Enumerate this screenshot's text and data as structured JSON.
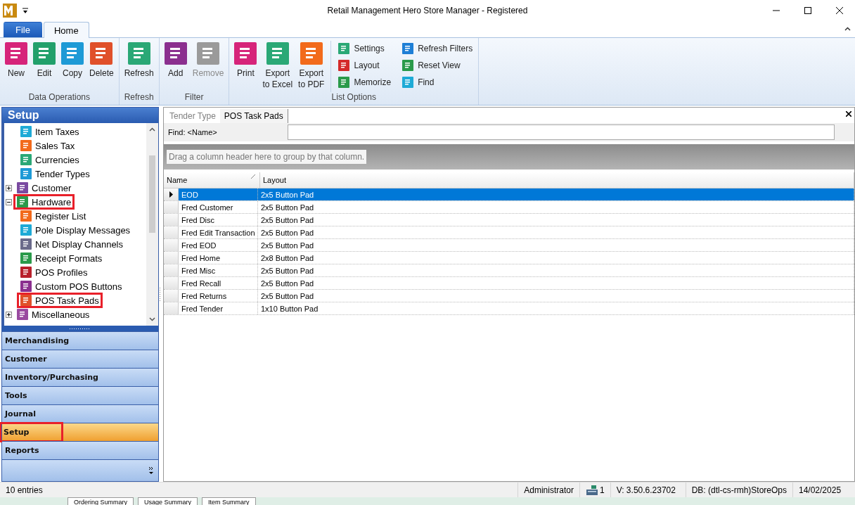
{
  "window": {
    "title": "Retail Management Hero Store Manager - Registered"
  },
  "ribbon_tabs": [
    {
      "label": "File",
      "kind": "file",
      "selected": false
    },
    {
      "label": "Home",
      "kind": "tab",
      "selected": true
    }
  ],
  "ribbon_groups": [
    {
      "label": "Data Operations",
      "buttons": [
        {
          "label": "New",
          "color": "#d6247a",
          "disabled": false
        },
        {
          "label": "Edit",
          "color": "#22a06b",
          "disabled": false
        },
        {
          "label": "Copy",
          "color": "#1e9ad6",
          "disabled": false
        },
        {
          "label": "Delete",
          "color": "#e0502a",
          "disabled": false
        }
      ]
    },
    {
      "label": "Refresh",
      "buttons": [
        {
          "label": "Refresh",
          "color": "#2aa876",
          "disabled": false
        }
      ]
    },
    {
      "label": "Filter",
      "buttons": [
        {
          "label": "Add",
          "color": "#8b2f8f",
          "disabled": false
        },
        {
          "label": "Remove",
          "color": "#9a9a9a",
          "disabled": true
        }
      ]
    },
    {
      "label": "List Options",
      "buttons": [
        {
          "label": "Print",
          "color": "#d6247a",
          "disabled": false
        },
        {
          "label": "Export\nto Excel",
          "color": "#2aa876",
          "disabled": false
        },
        {
          "label": "Export\nto PDF",
          "color": "#f26a1b",
          "disabled": false
        }
      ],
      "small_buttons": [
        {
          "label": "Settings",
          "color": "#2aa876"
        },
        {
          "label": "Layout",
          "color": "#d42a2a"
        },
        {
          "label": "Memorize",
          "color": "#2a9a4a"
        },
        {
          "label": "Refresh Filters",
          "color": "#1e7fd6"
        },
        {
          "label": "Reset View",
          "color": "#2a9a4a"
        },
        {
          "label": "Find",
          "color": "#1eaad6"
        }
      ]
    }
  ],
  "sidebar": {
    "title": "Setup",
    "tree": [
      {
        "children": [
          {
            "label": "Item Taxes",
            "color": "#1eaad6",
            "highlighted": false
          },
          {
            "label": "Sales Tax",
            "color": "#f26a1b",
            "highlighted": false
          },
          {
            "label": "Currencies",
            "color": "#2aa876",
            "highlighted": false
          },
          {
            "label": "Tender Types",
            "color": "#1e9ad6",
            "highlighted": false
          }
        ]
      },
      {
        "label": "Customer",
        "color": "#7a4aa0",
        "expanded": false,
        "highlighted": false
      },
      {
        "label": "Hardware",
        "color": "#2a9a4a",
        "expanded": true,
        "highlighted": true,
        "children": [
          {
            "label": "Register List",
            "color": "#f26a1b",
            "highlighted": false
          },
          {
            "label": "Pole Display Messages",
            "color": "#1eaad6",
            "highlighted": false
          },
          {
            "label": "Net Display Channels",
            "color": "#6a6a8a",
            "highlighted": false
          },
          {
            "label": "Receipt Formats",
            "color": "#2a9a4a",
            "highlighted": false
          },
          {
            "label": "POS Profiles",
            "color": "#b8202a",
            "highlighted": false
          },
          {
            "label": "Custom POS Buttons",
            "color": "#8b2f8f",
            "highlighted": false
          },
          {
            "label": "POS Task Pads",
            "color": "#e0502a",
            "highlighted": true
          }
        ]
      },
      {
        "label": "Miscellaneous",
        "color": "#9a4aa0",
        "expanded": false,
        "highlighted": false
      }
    ],
    "nav": [
      {
        "label": "Merchandising",
        "selected": false,
        "highlighted": false
      },
      {
        "label": "Customer",
        "selected": false,
        "highlighted": false
      },
      {
        "label": "Inventory/Purchasing",
        "selected": false,
        "highlighted": false
      },
      {
        "label": "Tools",
        "selected": false,
        "highlighted": false
      },
      {
        "label": "Journal",
        "selected": false,
        "highlighted": false
      },
      {
        "label": "Setup",
        "selected": true,
        "highlighted": true
      },
      {
        "label": "Reports",
        "selected": false,
        "highlighted": false
      }
    ]
  },
  "document_tabs": [
    {
      "label": "Tender Type",
      "selected": false
    },
    {
      "label": "POS Task Pads",
      "selected": true
    }
  ],
  "find": {
    "label": "Find: <Name>"
  },
  "group_panel": {
    "hint": "Drag a column header here to group by that column."
  },
  "table": {
    "columns": [
      {
        "label": "Name",
        "sorted": true
      },
      {
        "label": "Layout",
        "sorted": false
      }
    ],
    "rows": [
      {
        "cells": [
          "EOD",
          "2x5 Button Pad"
        ],
        "selected": true
      },
      {
        "cells": [
          "Fred Customer",
          "2x5 Button Pad"
        ],
        "selected": false
      },
      {
        "cells": [
          "Fred Disc",
          "2x5 Button Pad"
        ],
        "selected": false
      },
      {
        "cells": [
          "Fred Edit Transaction",
          "2x5 Button Pad"
        ],
        "selected": false
      },
      {
        "cells": [
          "Fred EOD",
          "2x5 Button Pad"
        ],
        "selected": false
      },
      {
        "cells": [
          "Fred Home",
          "2x8 Button Pad"
        ],
        "selected": false
      },
      {
        "cells": [
          "Fred Misc",
          "2x5 Button Pad"
        ],
        "selected": false
      },
      {
        "cells": [
          "Fred Recall",
          "2x5 Button Pad"
        ],
        "selected": false
      },
      {
        "cells": [
          "Fred Returns",
          "2x5 Button Pad"
        ],
        "selected": false
      },
      {
        "cells": [
          "Fred Tender",
          "1x10 Button Pad"
        ],
        "selected": false
      }
    ]
  },
  "status_bar": {
    "entries": "10 entries",
    "user": "Administrator",
    "register": "1",
    "version": "V: 3.50.6.23702",
    "database": "DB: (dtl-cs-rmh)StoreOps",
    "date": "14/02/2025"
  },
  "background_tabs": [
    "Ordering Summary",
    "Usage Summary",
    "Item Summary"
  ]
}
